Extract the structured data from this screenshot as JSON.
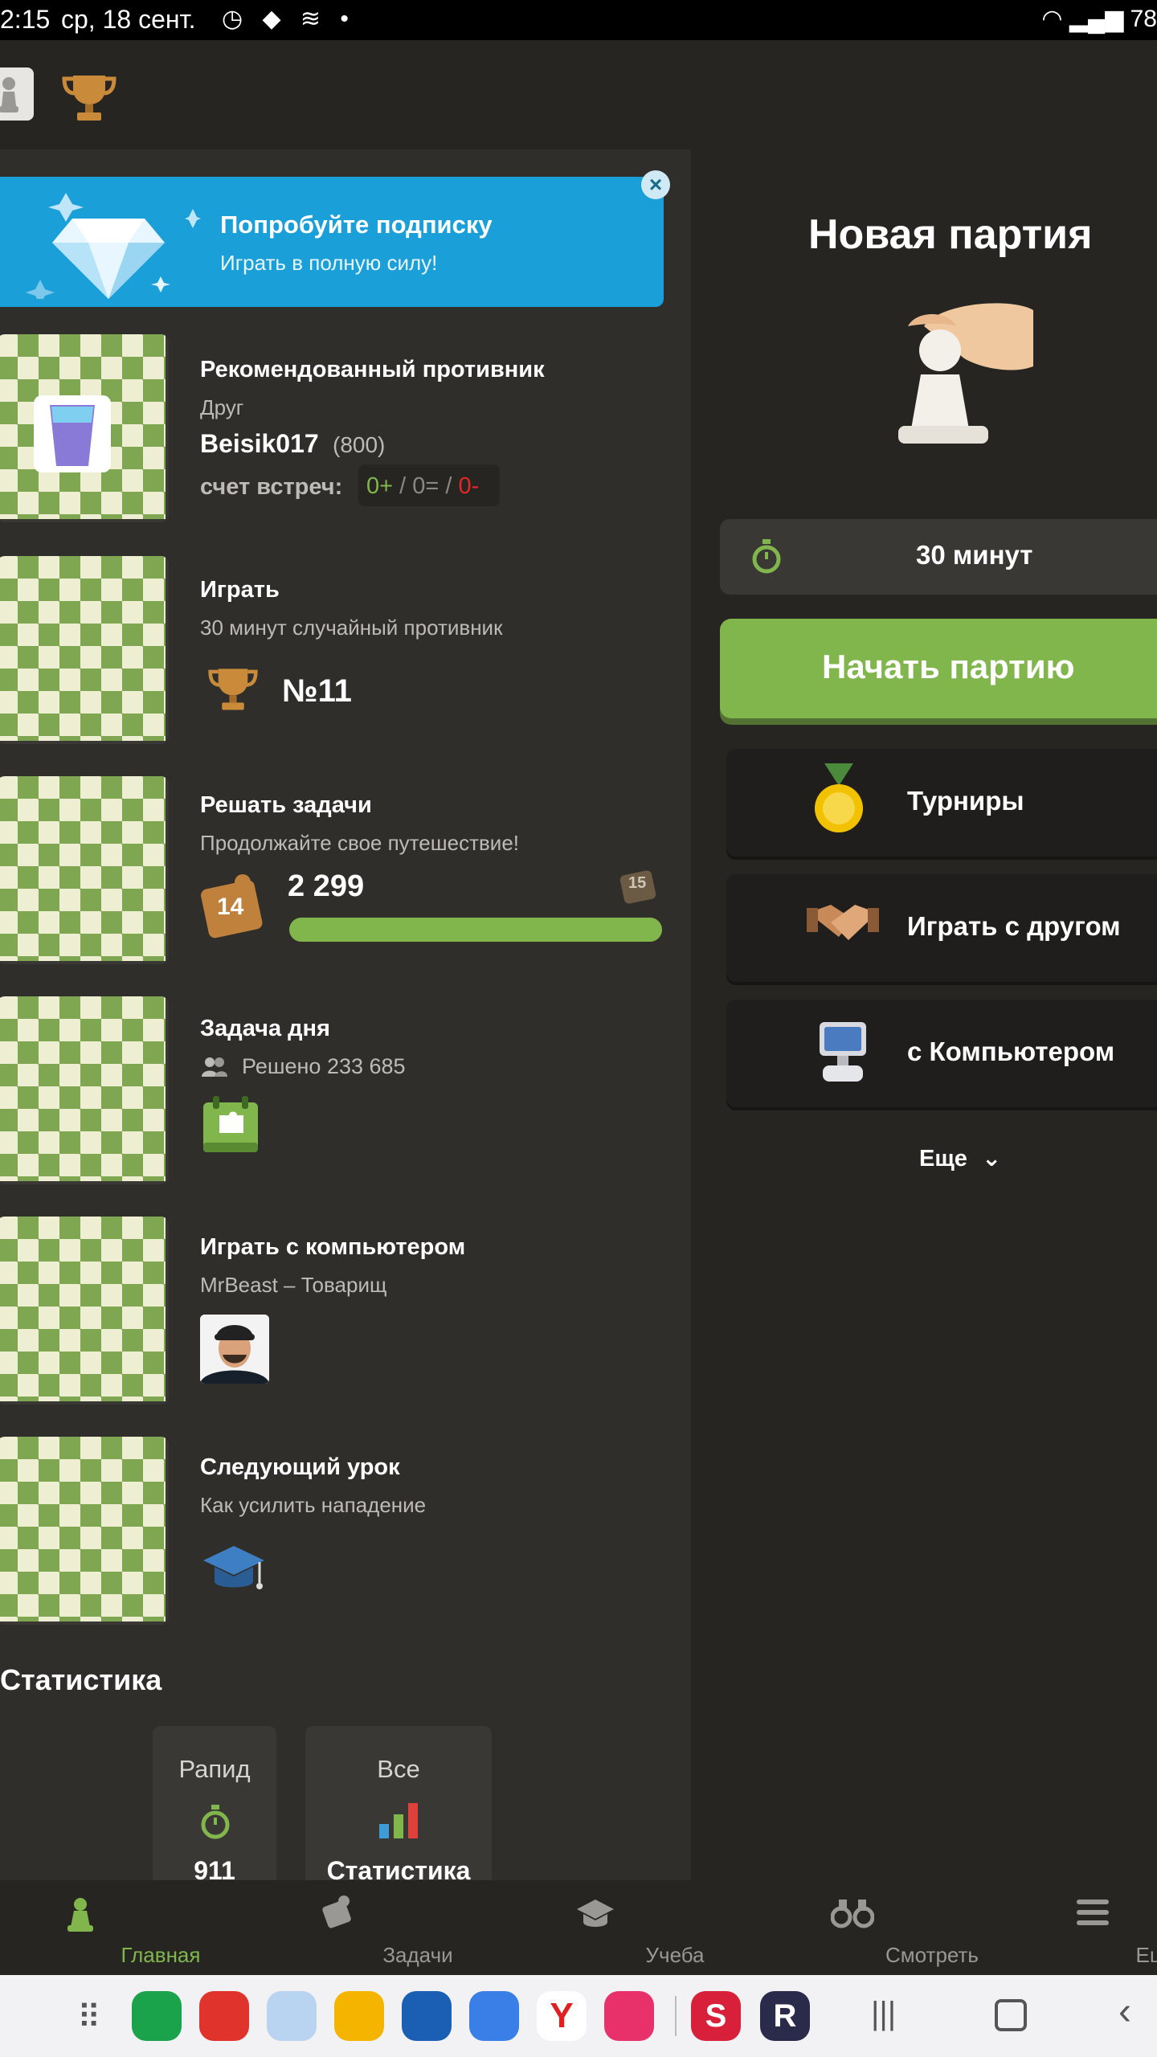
{
  "status_bar": {
    "time": "2:15",
    "date": "ср, 18 сент.",
    "battery": "78"
  },
  "promo": {
    "title": "Попробуйте подписку",
    "subtitle": "Играть в полную силу!"
  },
  "cards": {
    "recommended": {
      "title": "Рекомендованный противник",
      "subtitle": "Друг",
      "name": "Beisik017",
      "rating": "(800)",
      "score_label": "счет встреч:",
      "wins": "0+",
      "sep1": " / ",
      "draws": "0=",
      "sep2": " / ",
      "losses": "0-"
    },
    "play": {
      "title": "Играть",
      "subtitle": "30 минут случайный противник",
      "rank": "№11"
    },
    "puzzles": {
      "title": "Решать задачи",
      "subtitle": "Продолжайте свое путешествие!",
      "level": "14",
      "next_level": "15",
      "rating": "2 299",
      "progress": 1.0
    },
    "daily": {
      "title": "Задача дня",
      "solved": "Решено 233 685"
    },
    "computer": {
      "title": "Играть с компьютером",
      "subtitle": "MrBeast – Товарищ"
    },
    "lesson": {
      "title": "Следующий урок",
      "subtitle": "Как усилить нападение"
    }
  },
  "stats": {
    "title": "Статистика",
    "rapid_label": "Рапид",
    "rapid_value": "911",
    "all_label": "Все",
    "all_value": "Статистика"
  },
  "new_game": {
    "title": "Новая партия",
    "time_control": "30 минут",
    "start_button": "Начать партию",
    "tournaments": "Турниры",
    "play_friend": "Играть с другом",
    "vs_computer": "с Компьютером",
    "more": "Еще"
  },
  "bottom_nav": {
    "home": "Главная",
    "puzzles": "Задачи",
    "learn": "Учеба",
    "watch": "Смотреть",
    "more": "Еще"
  },
  "colors": {
    "accent_green": "#81b64c",
    "promo_blue": "#1a9fd9",
    "loss_red": "#e02828",
    "background": "#302e2b"
  }
}
